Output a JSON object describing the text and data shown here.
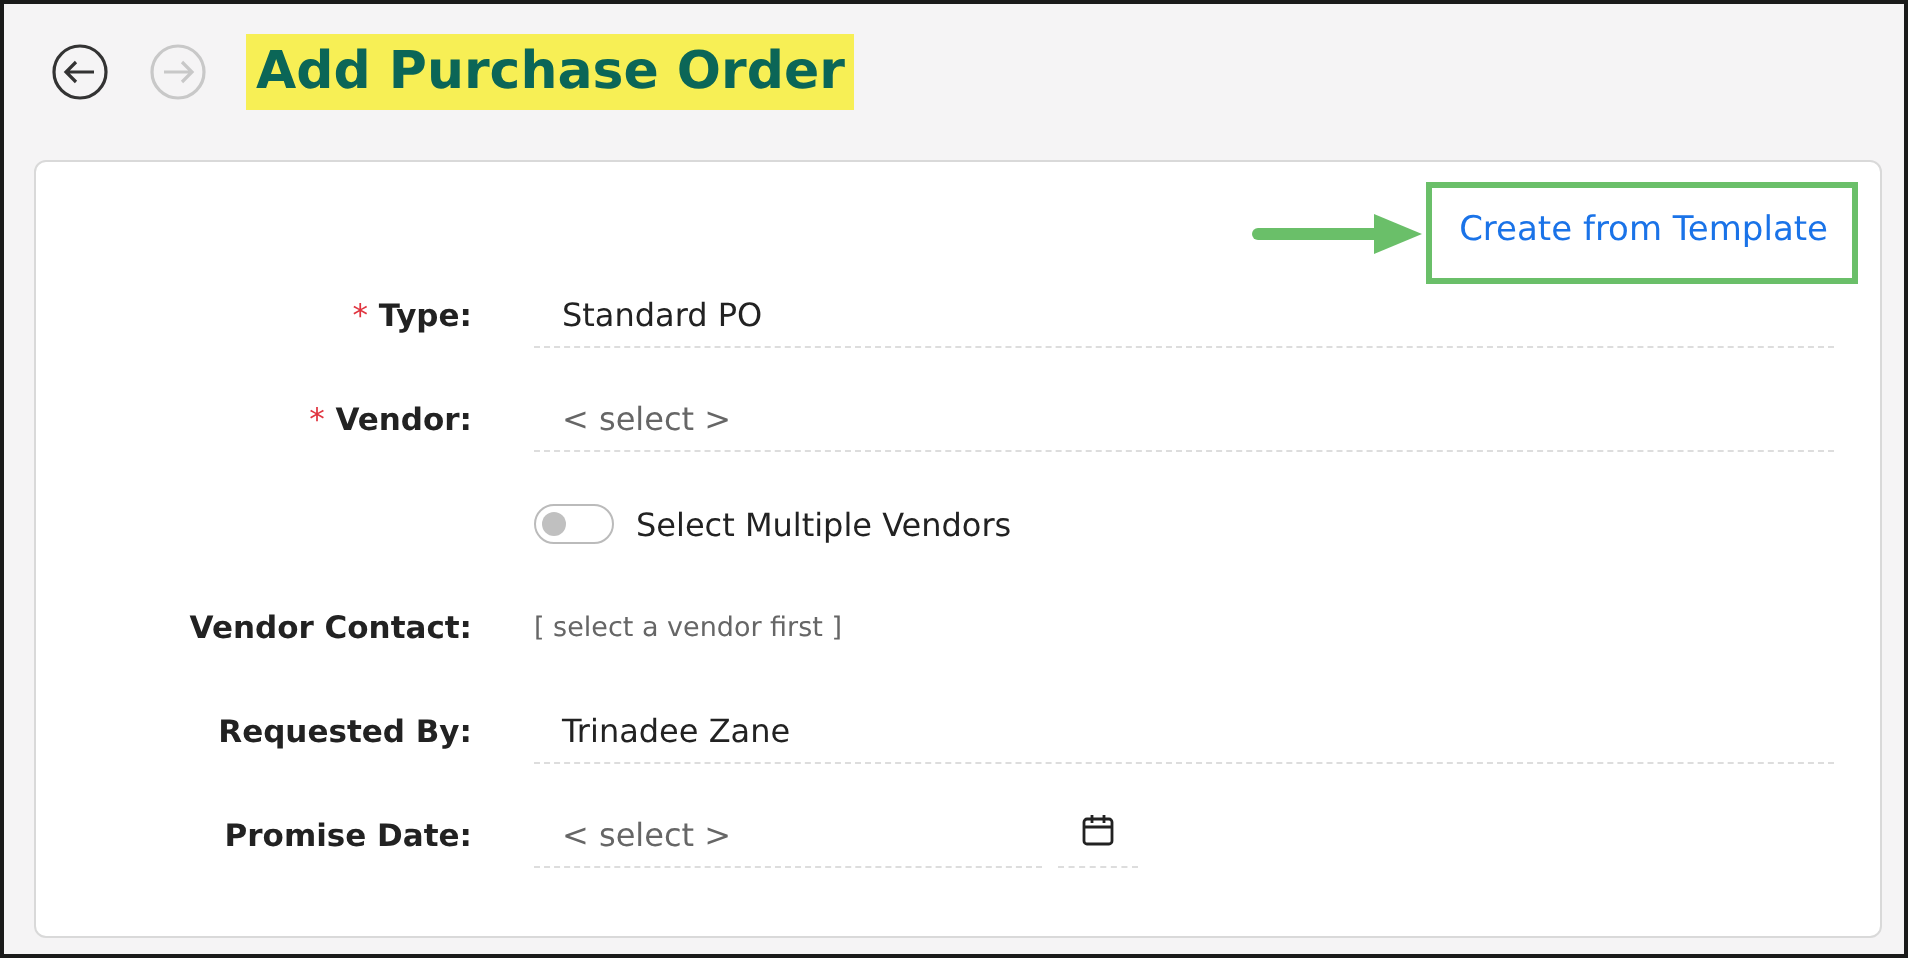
{
  "header": {
    "back_enabled": true,
    "forward_enabled": false,
    "title": "Add Purchase Order"
  },
  "template_link": {
    "label": "Create from Template"
  },
  "form": [
    {
      "kind": "field",
      "required_mark": "*",
      "label": "Type:",
      "value": "Standard PO"
    },
    {
      "kind": "field",
      "required_mark": "*",
      "label": "Vendor:",
      "placeholder": "< select >"
    },
    {
      "kind": "toggle",
      "on": false,
      "label": "Select Multiple Vendors"
    },
    {
      "kind": "note",
      "label": "Vendor Contact:",
      "note": "[ select a vendor first ]"
    },
    {
      "kind": "field",
      "label": "Requested By:",
      "value": "Trinadee Zane"
    },
    {
      "kind": "date",
      "label": "Promise Date:",
      "placeholder": "< select >"
    }
  ]
}
